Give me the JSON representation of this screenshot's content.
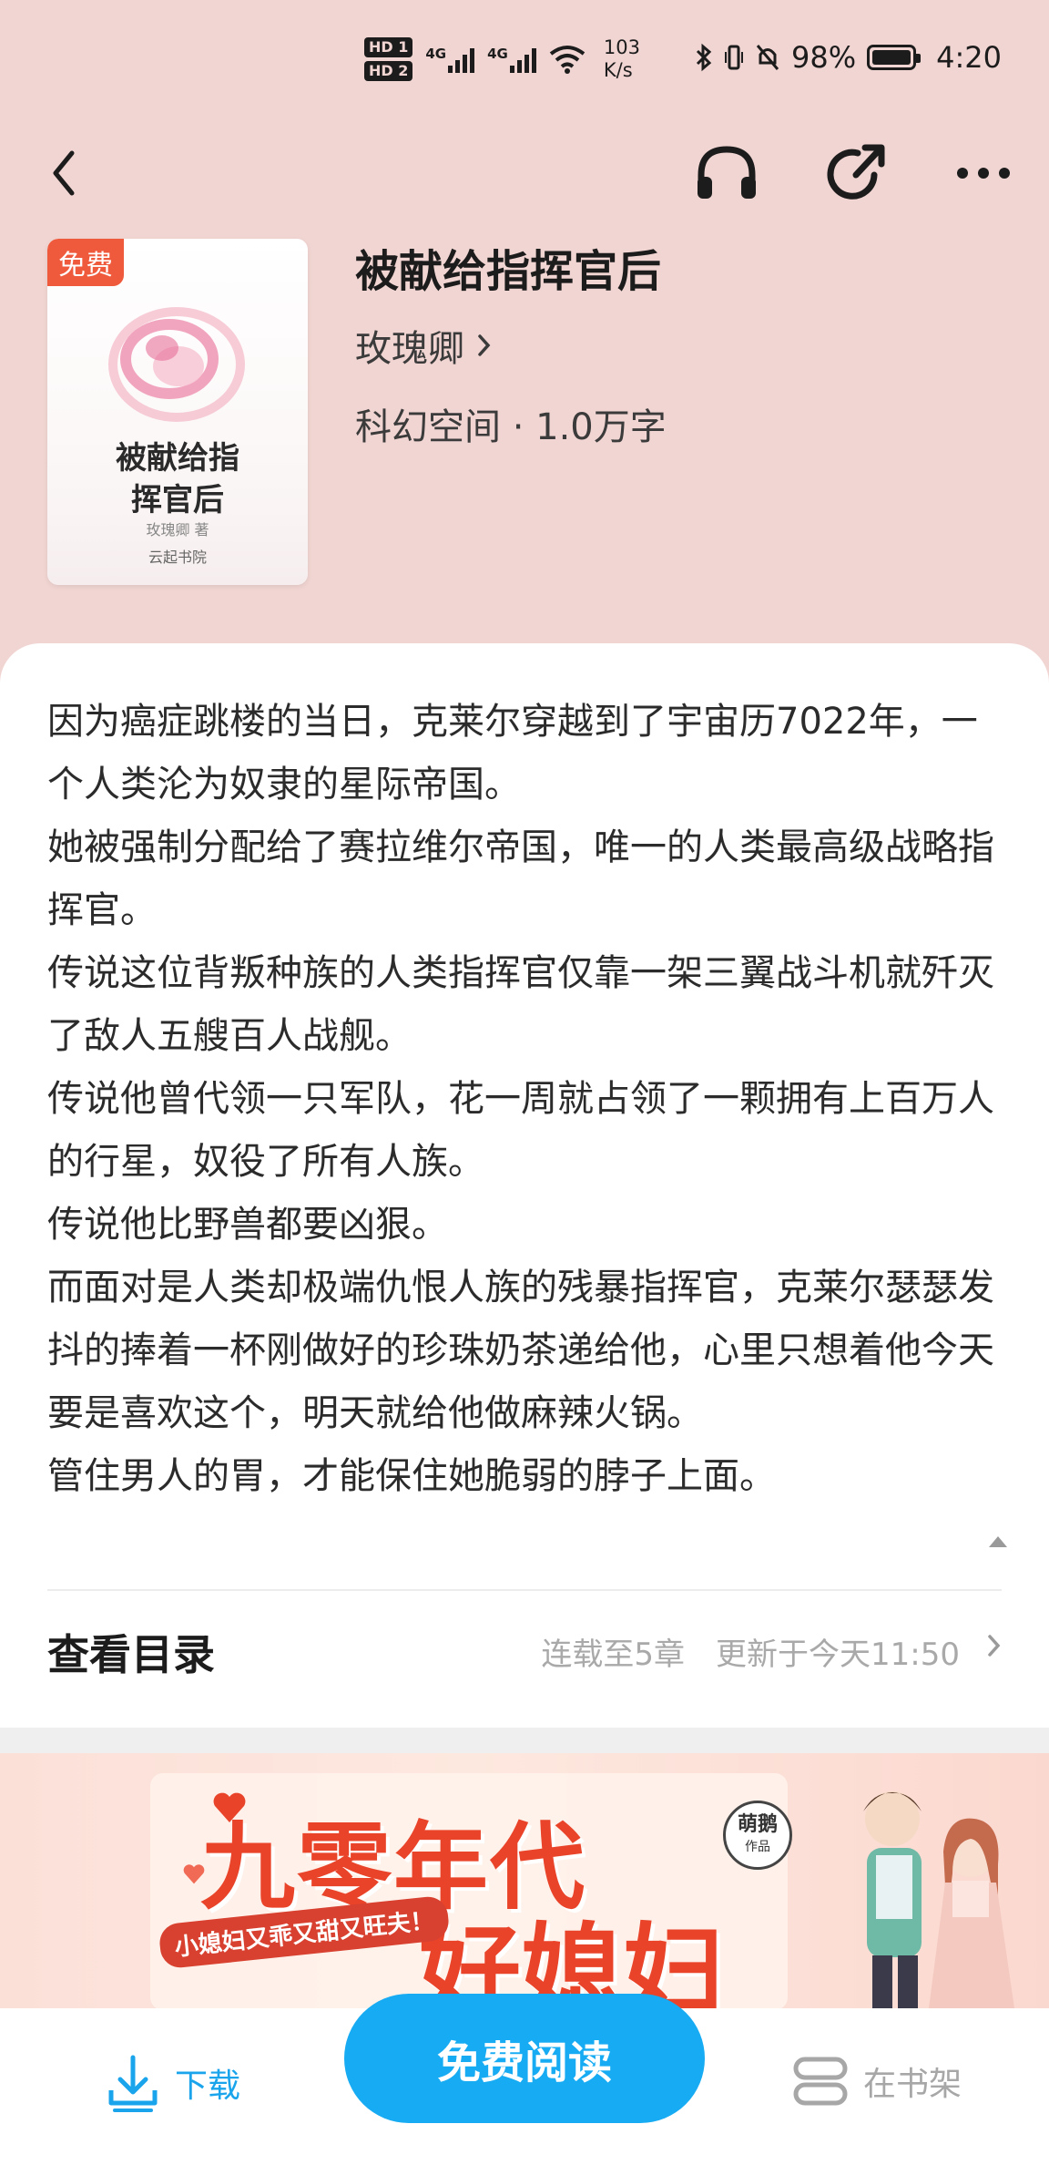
{
  "status_bar": {
    "hd1": "HD 1",
    "hd2": "HD 2",
    "net1": "4G",
    "net2": "4G",
    "speed_value": "103",
    "speed_unit": "K/s",
    "battery": "98%",
    "time": "4:20"
  },
  "book": {
    "cover_tag": "免费",
    "cover_title_line1": "被献给指",
    "cover_title_line2": "挥官后",
    "cover_author": "玫瑰卿 著",
    "cover_publisher": "云起书院",
    "title": "被献给指挥官后",
    "author": "玫瑰卿",
    "meta": "科幻空间 · 1.0万字"
  },
  "synopsis": [
    "因为癌症跳楼的当日，克莱尔穿越到了宇宙历7022年，一个人类沦为奴隶的星际帝国。",
    "她被强制分配给了赛拉维尔帝国，唯一的人类最高级战略指挥官。",
    "传说这位背叛种族的人类指挥官仅靠一架三翼战斗机就歼灭了敌人五艘百人战舰。",
    "传说他曾代领一只军队，花一周就占领了一颗拥有上百万人的行星，奴役了所有人族。",
    "传说他比野兽都要凶狠。",
    "而面对是人类却极端仇恨人族的残暴指挥官，克莱尔瑟瑟发抖的捧着一杯刚做好的珍珠奶茶递给他，心里只想着他今天要是喜欢这个，明天就给他做麻辣火锅。",
    "管住男人的胃，才能保住她脆弱的脖子上面。"
  ],
  "toc": {
    "title": "查看目录",
    "status": "连载至5章　更新于今天11:50"
  },
  "banner": {
    "title1": "九零年代",
    "title2": "好媳妇",
    "slogan": "小媳妇又乖又甜又旺夫！",
    "badge_top": "萌鹅",
    "badge_bottom": "作品"
  },
  "bottom_bar": {
    "download": "下载",
    "read": "免费阅读",
    "shelf": "在书架"
  },
  "colors": {
    "header_bg": "#f1d5d2",
    "accent": "#16abf2",
    "tag": "#f05a3c"
  }
}
